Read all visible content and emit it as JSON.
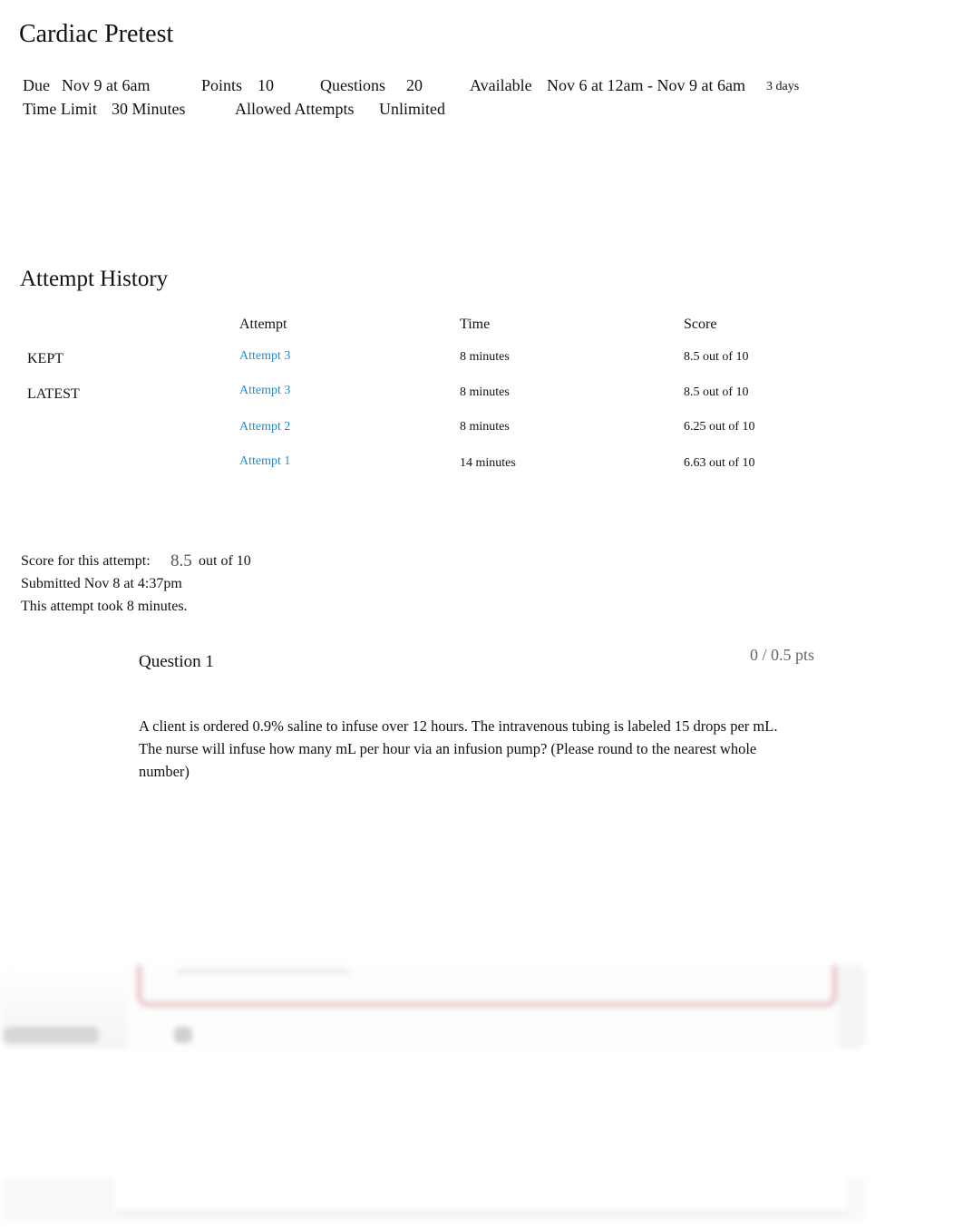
{
  "page": {
    "title": "Cardiac Pretest"
  },
  "quiz_info": {
    "due_label": "Due",
    "due_value": "Nov 9 at 6am",
    "points_label": "Points",
    "points_value": "10",
    "questions_label": "Questions",
    "questions_value": "20",
    "available_label": "Available",
    "available_value": "Nov 6 at 12am - Nov 9 at 6am",
    "available_duration": "3 days",
    "time_limit_label": "Time Limit",
    "time_limit_value": "30 Minutes",
    "allowed_attempts_label": "Allowed Attempts",
    "allowed_attempts_value": "Unlimited"
  },
  "attempt_history": {
    "title": "Attempt History",
    "columns": [
      "",
      "Attempt",
      "Time",
      "Score"
    ],
    "rows": [
      {
        "label": "KEPT",
        "attempt": "Attempt 3",
        "time": "8 minutes",
        "score": "8.5 out of 10"
      },
      {
        "label": "LATEST",
        "attempt": "Attempt 3",
        "time": "8 minutes",
        "score": "8.5 out of 10"
      },
      {
        "label": "",
        "attempt": "Attempt 2",
        "time": "8 minutes",
        "score": "6.25 out of 10"
      },
      {
        "label": "",
        "attempt": "Attempt 1",
        "time": "14 minutes",
        "score": "6.63 out of 10"
      }
    ],
    "link_color": "#1a8fd6"
  },
  "attempt_summary": {
    "score_label": "Score for this attempt:",
    "score_value": "8.5",
    "score_suffix": "out of 10",
    "submitted": "Submitted Nov 8 at 4:37pm",
    "duration": "This attempt took 8 minutes."
  },
  "question": {
    "title": "Question 1",
    "points": "0 / 0.5 pts",
    "text": "A client is ordered 0.9% saline to infuse over 12 hours. The intravenous tubing is labeled 15 drops per mL. The nurse will infuse how many mL per hour via an infusion pump? (Please round to the nearest whole number)",
    "answer_border_color": "#eccfd2"
  }
}
